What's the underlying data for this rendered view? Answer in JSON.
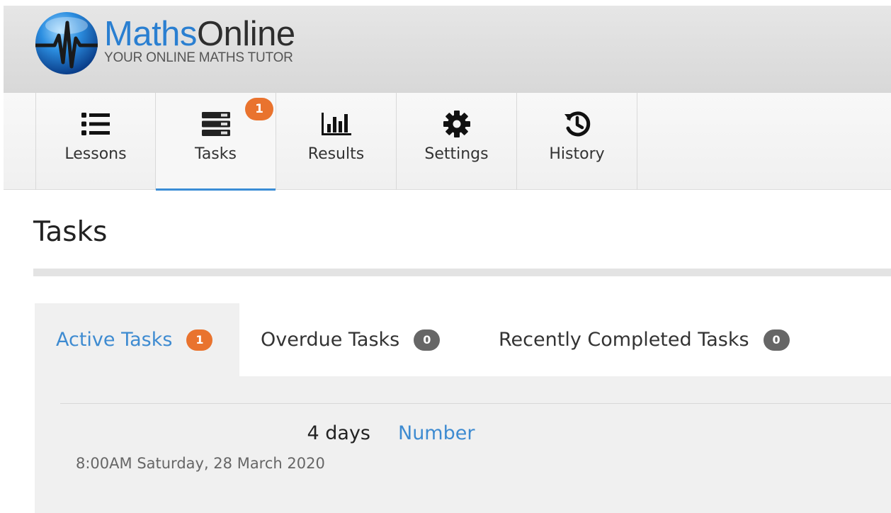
{
  "logo": {
    "brand_first": "Maths",
    "brand_second": "Online",
    "tagline": "YOUR ONLINE MATHS TUTOR",
    "colors": {
      "maths": "#2a7fd1",
      "online": "#2e2e2e"
    }
  },
  "nav": {
    "items": [
      {
        "label": "Lessons",
        "icon": "list-icon"
      },
      {
        "label": "Tasks",
        "icon": "tasks-icon",
        "badge": "1",
        "active": true
      },
      {
        "label": "Results",
        "icon": "bar-chart-icon"
      },
      {
        "label": "Settings",
        "icon": "gear-icon"
      },
      {
        "label": "History",
        "icon": "history-icon"
      }
    ]
  },
  "page": {
    "title": "Tasks"
  },
  "tabs": [
    {
      "label": "Active Tasks",
      "count": "1",
      "active": true
    },
    {
      "label": "Overdue Tasks",
      "count": "0"
    },
    {
      "label": "Recently Completed Tasks",
      "count": "0"
    }
  ],
  "task": {
    "due_in": "4 days",
    "subject": "Number",
    "due_date": "8:00AM Saturday, 28 March 2020"
  },
  "colors": {
    "accent": "#3e8bd1",
    "badge_orange": "#e9732e",
    "badge_grey": "#666666"
  }
}
